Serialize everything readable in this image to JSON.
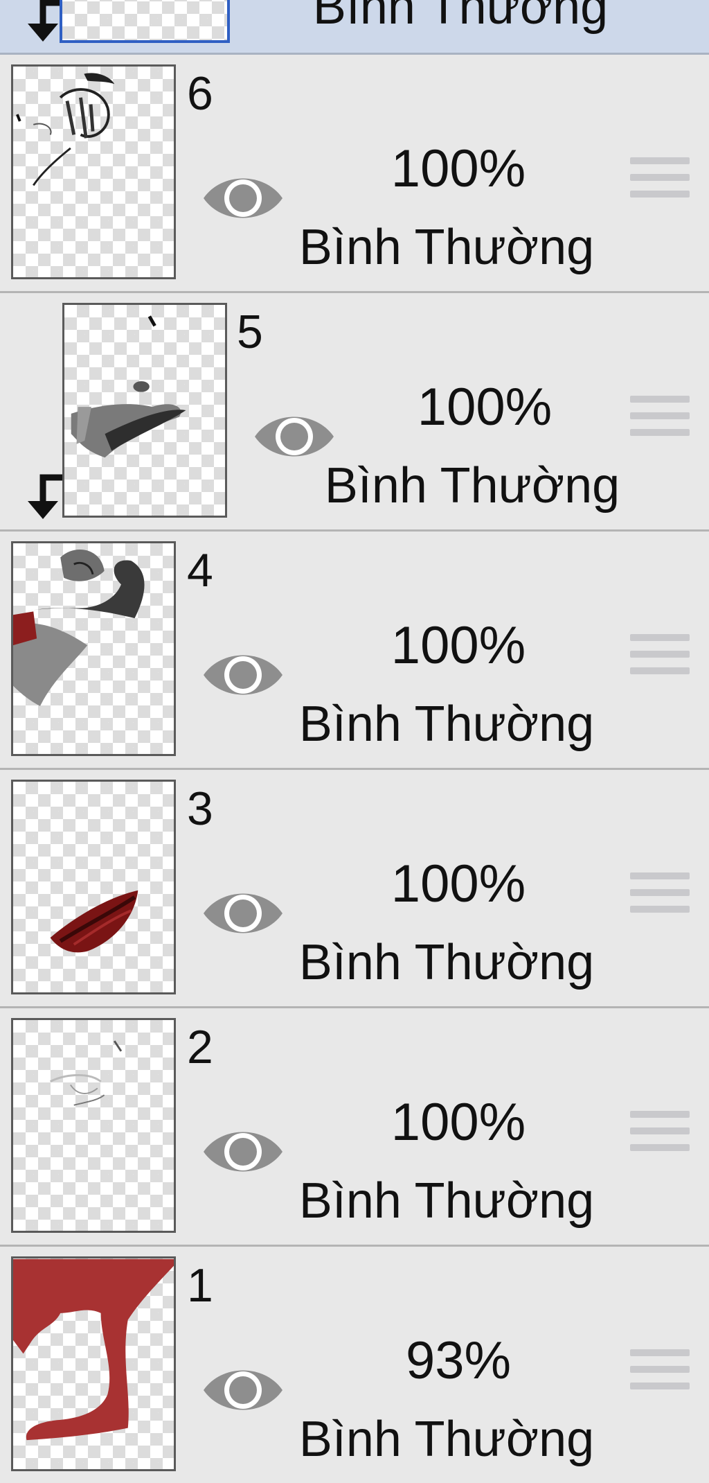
{
  "layers_panel": {
    "top_layer": {
      "blend": "Bình Thường"
    },
    "layers": [
      {
        "number": "6",
        "opacity": "100%",
        "blend": "Bình Thường"
      },
      {
        "number": "5",
        "opacity": "100%",
        "blend": "Bình Thường"
      },
      {
        "number": "4",
        "opacity": "100%",
        "blend": "Bình Thường"
      },
      {
        "number": "3",
        "opacity": "100%",
        "blend": "Bình Thường"
      },
      {
        "number": "2",
        "opacity": "100%",
        "blend": "Bình Thường"
      },
      {
        "number": "1",
        "opacity": "93%",
        "blend": "Bình Thường"
      }
    ]
  },
  "icons": {
    "visibility": "eye-icon",
    "reorder": "drag-handle-icon",
    "clipping": "clipping-arrow-icon"
  },
  "colors": {
    "selected_row": "#cdd8ea",
    "row": "#e8e8e8",
    "selected_border": "#2f5fc3",
    "eye": "#8e8e8e",
    "handle": "#c9c9cc"
  }
}
